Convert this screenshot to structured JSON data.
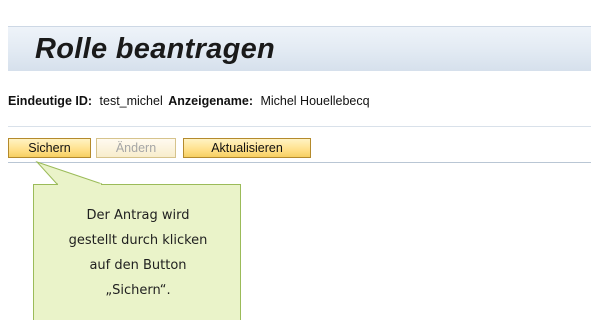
{
  "page": {
    "title": "Rolle beantragen"
  },
  "info": {
    "id_label": "Eindeutige ID:",
    "id_value": "test_michel",
    "name_label": "Anzeigename:",
    "name_value": "Michel Houellebecq"
  },
  "toolbar": {
    "save_label": "Sichern",
    "edit_label": "Ändern",
    "refresh_label": "Aktualisieren"
  },
  "callout": {
    "line1": "Der Antrag wird",
    "line2": "gestellt durch klicken",
    "line3": "auf den Button",
    "line4": "„Sichern“."
  },
  "colors": {
    "button_fill": "#ffe08a",
    "button_border": "#b48a2c",
    "callout_fill": "#eaf3c9",
    "callout_border": "#9bbb59",
    "header_fill": "#e2eaf3"
  }
}
